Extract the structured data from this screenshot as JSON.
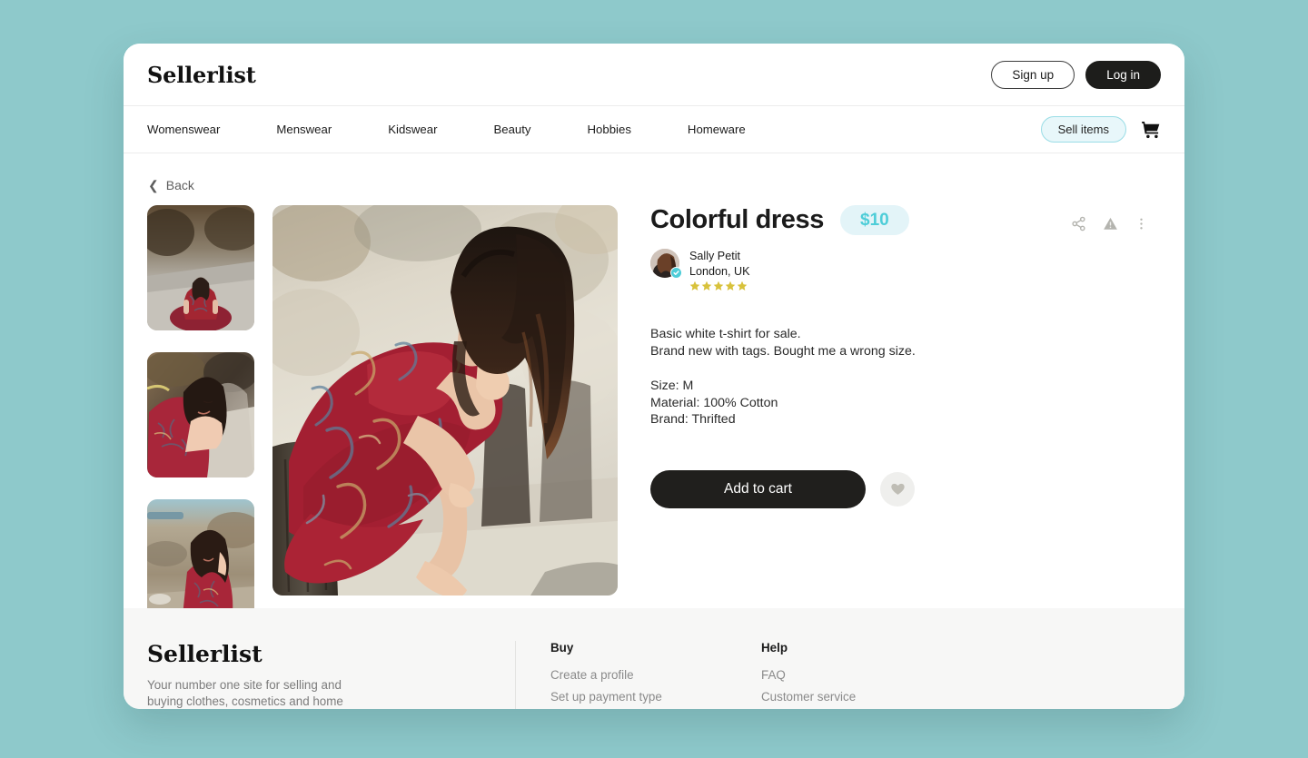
{
  "page": {
    "background_color": "#8ec9cb",
    "card_background": "#ffffff"
  },
  "header": {
    "brand": "Sellerlist",
    "signup_label": "Sign up",
    "login_label": "Log in"
  },
  "nav": {
    "items": [
      {
        "label": "Womenswear"
      },
      {
        "label": "Menswear"
      },
      {
        "label": "Kidswear"
      },
      {
        "label": "Beauty"
      },
      {
        "label": "Hobbies"
      },
      {
        "label": "Homeware"
      }
    ],
    "sell_label": "Sell items",
    "cart_icon": "shopping-cart-icon"
  },
  "breadcrumb": {
    "back_label": "Back",
    "back_icon": "chevron-left-icon"
  },
  "product": {
    "title": "Colorful dress",
    "price": "$10",
    "price_color": "#4ecdd8",
    "price_badge_color": "#e3f4f8",
    "gallery": {
      "thumbnails": [
        {
          "alt": "Woman in red paisley dress sitting cross-legged on a path"
        },
        {
          "alt": "Woman in red paisley dress leaning on a ledge smiling"
        },
        {
          "alt": "Woman in red paisley dress kneeling on rocks by the shore"
        }
      ],
      "hero": {
        "alt": "Woman in red paisley dress sitting on a wooden post at the beach"
      }
    },
    "seller": {
      "name": "Sally Petit",
      "location": "London, UK",
      "verified": true,
      "verified_icon": "verified-check-icon",
      "rating": 5,
      "star_color": "#d8c23c"
    },
    "description_lines": [
      "Basic white t-shirt for sale.",
      "Brand new with tags. Bought me a wrong size."
    ],
    "spec_lines": [
      "Size: M",
      "Material: 100% Cotton",
      "Brand: Thrifted"
    ],
    "add_to_cart_label": "Add to cart",
    "favorite_icon": "heart-icon",
    "actions": [
      {
        "icon": "share-icon"
      },
      {
        "icon": "report-warning-icon"
      },
      {
        "icon": "more-vertical-icon"
      }
    ]
  },
  "footer": {
    "brand": "Sellerlist",
    "tagline": "Your number one site for selling and buying clothes, cosmetics and home goods.",
    "columns": [
      {
        "title": "Buy",
        "links": [
          {
            "label": "Create a profile"
          },
          {
            "label": "Set up payment type"
          }
        ]
      },
      {
        "title": "Help",
        "links": [
          {
            "label": "FAQ"
          },
          {
            "label": "Customer service"
          }
        ]
      }
    ]
  }
}
